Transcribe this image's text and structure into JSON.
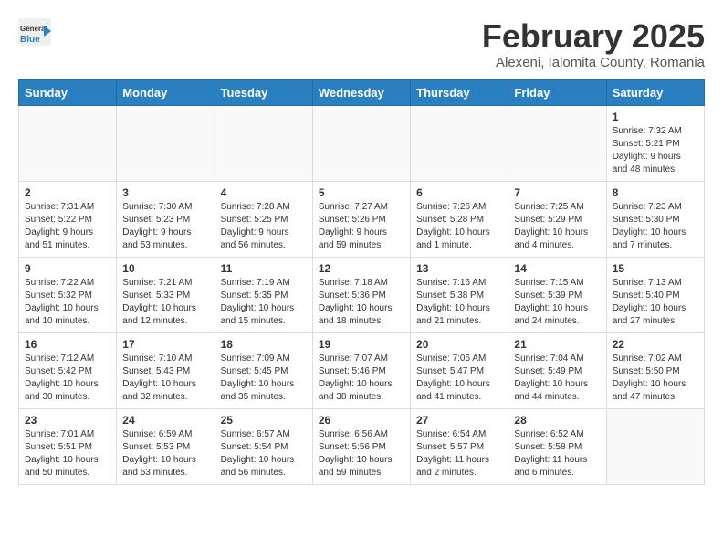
{
  "header": {
    "logo_line1": "General",
    "logo_line2": "Blue",
    "title": "February 2025",
    "subtitle": "Alexeni, Ialomita County, Romania"
  },
  "weekdays": [
    "Sunday",
    "Monday",
    "Tuesday",
    "Wednesday",
    "Thursday",
    "Friday",
    "Saturday"
  ],
  "weeks": [
    [
      {
        "day": "",
        "info": ""
      },
      {
        "day": "",
        "info": ""
      },
      {
        "day": "",
        "info": ""
      },
      {
        "day": "",
        "info": ""
      },
      {
        "day": "",
        "info": ""
      },
      {
        "day": "",
        "info": ""
      },
      {
        "day": "1",
        "info": "Sunrise: 7:32 AM\nSunset: 5:21 PM\nDaylight: 9 hours and 48 minutes."
      }
    ],
    [
      {
        "day": "2",
        "info": "Sunrise: 7:31 AM\nSunset: 5:22 PM\nDaylight: 9 hours and 51 minutes."
      },
      {
        "day": "3",
        "info": "Sunrise: 7:30 AM\nSunset: 5:23 PM\nDaylight: 9 hours and 53 minutes."
      },
      {
        "day": "4",
        "info": "Sunrise: 7:28 AM\nSunset: 5:25 PM\nDaylight: 9 hours and 56 minutes."
      },
      {
        "day": "5",
        "info": "Sunrise: 7:27 AM\nSunset: 5:26 PM\nDaylight: 9 hours and 59 minutes."
      },
      {
        "day": "6",
        "info": "Sunrise: 7:26 AM\nSunset: 5:28 PM\nDaylight: 10 hours and 1 minute."
      },
      {
        "day": "7",
        "info": "Sunrise: 7:25 AM\nSunset: 5:29 PM\nDaylight: 10 hours and 4 minutes."
      },
      {
        "day": "8",
        "info": "Sunrise: 7:23 AM\nSunset: 5:30 PM\nDaylight: 10 hours and 7 minutes."
      }
    ],
    [
      {
        "day": "9",
        "info": "Sunrise: 7:22 AM\nSunset: 5:32 PM\nDaylight: 10 hours and 10 minutes."
      },
      {
        "day": "10",
        "info": "Sunrise: 7:21 AM\nSunset: 5:33 PM\nDaylight: 10 hours and 12 minutes."
      },
      {
        "day": "11",
        "info": "Sunrise: 7:19 AM\nSunset: 5:35 PM\nDaylight: 10 hours and 15 minutes."
      },
      {
        "day": "12",
        "info": "Sunrise: 7:18 AM\nSunset: 5:36 PM\nDaylight: 10 hours and 18 minutes."
      },
      {
        "day": "13",
        "info": "Sunrise: 7:16 AM\nSunset: 5:38 PM\nDaylight: 10 hours and 21 minutes."
      },
      {
        "day": "14",
        "info": "Sunrise: 7:15 AM\nSunset: 5:39 PM\nDaylight: 10 hours and 24 minutes."
      },
      {
        "day": "15",
        "info": "Sunrise: 7:13 AM\nSunset: 5:40 PM\nDaylight: 10 hours and 27 minutes."
      }
    ],
    [
      {
        "day": "16",
        "info": "Sunrise: 7:12 AM\nSunset: 5:42 PM\nDaylight: 10 hours and 30 minutes."
      },
      {
        "day": "17",
        "info": "Sunrise: 7:10 AM\nSunset: 5:43 PM\nDaylight: 10 hours and 32 minutes."
      },
      {
        "day": "18",
        "info": "Sunrise: 7:09 AM\nSunset: 5:45 PM\nDaylight: 10 hours and 35 minutes."
      },
      {
        "day": "19",
        "info": "Sunrise: 7:07 AM\nSunset: 5:46 PM\nDaylight: 10 hours and 38 minutes."
      },
      {
        "day": "20",
        "info": "Sunrise: 7:06 AM\nSunset: 5:47 PM\nDaylight: 10 hours and 41 minutes."
      },
      {
        "day": "21",
        "info": "Sunrise: 7:04 AM\nSunset: 5:49 PM\nDaylight: 10 hours and 44 minutes."
      },
      {
        "day": "22",
        "info": "Sunrise: 7:02 AM\nSunset: 5:50 PM\nDaylight: 10 hours and 47 minutes."
      }
    ],
    [
      {
        "day": "23",
        "info": "Sunrise: 7:01 AM\nSunset: 5:51 PM\nDaylight: 10 hours and 50 minutes."
      },
      {
        "day": "24",
        "info": "Sunrise: 6:59 AM\nSunset: 5:53 PM\nDaylight: 10 hours and 53 minutes."
      },
      {
        "day": "25",
        "info": "Sunrise: 6:57 AM\nSunset: 5:54 PM\nDaylight: 10 hours and 56 minutes."
      },
      {
        "day": "26",
        "info": "Sunrise: 6:56 AM\nSunset: 5:56 PM\nDaylight: 10 hours and 59 minutes."
      },
      {
        "day": "27",
        "info": "Sunrise: 6:54 AM\nSunset: 5:57 PM\nDaylight: 11 hours and 2 minutes."
      },
      {
        "day": "28",
        "info": "Sunrise: 6:52 AM\nSunset: 5:58 PM\nDaylight: 11 hours and 6 minutes."
      },
      {
        "day": "",
        "info": ""
      }
    ]
  ]
}
